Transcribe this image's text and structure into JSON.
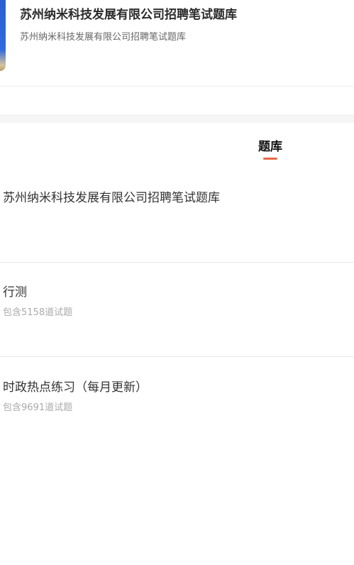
{
  "header": {
    "title": "苏州纳米科技发展有限公司招聘笔试题库",
    "subtitle": "苏州纳米科技发展有限公司招聘笔试题库"
  },
  "tabs": [
    {
      "label": "题库",
      "active": true
    }
  ],
  "bank": {
    "title": "苏州纳米科技发展有限公司招聘笔试题库",
    "items": [
      {
        "name": "行测",
        "count": "包含5158道试题"
      },
      {
        "name": "时政热点练习（每月更新）",
        "count": "包含9691道试题"
      }
    ]
  },
  "colors": {
    "accent": "#e8684a",
    "cover": "#2f6ae0"
  }
}
